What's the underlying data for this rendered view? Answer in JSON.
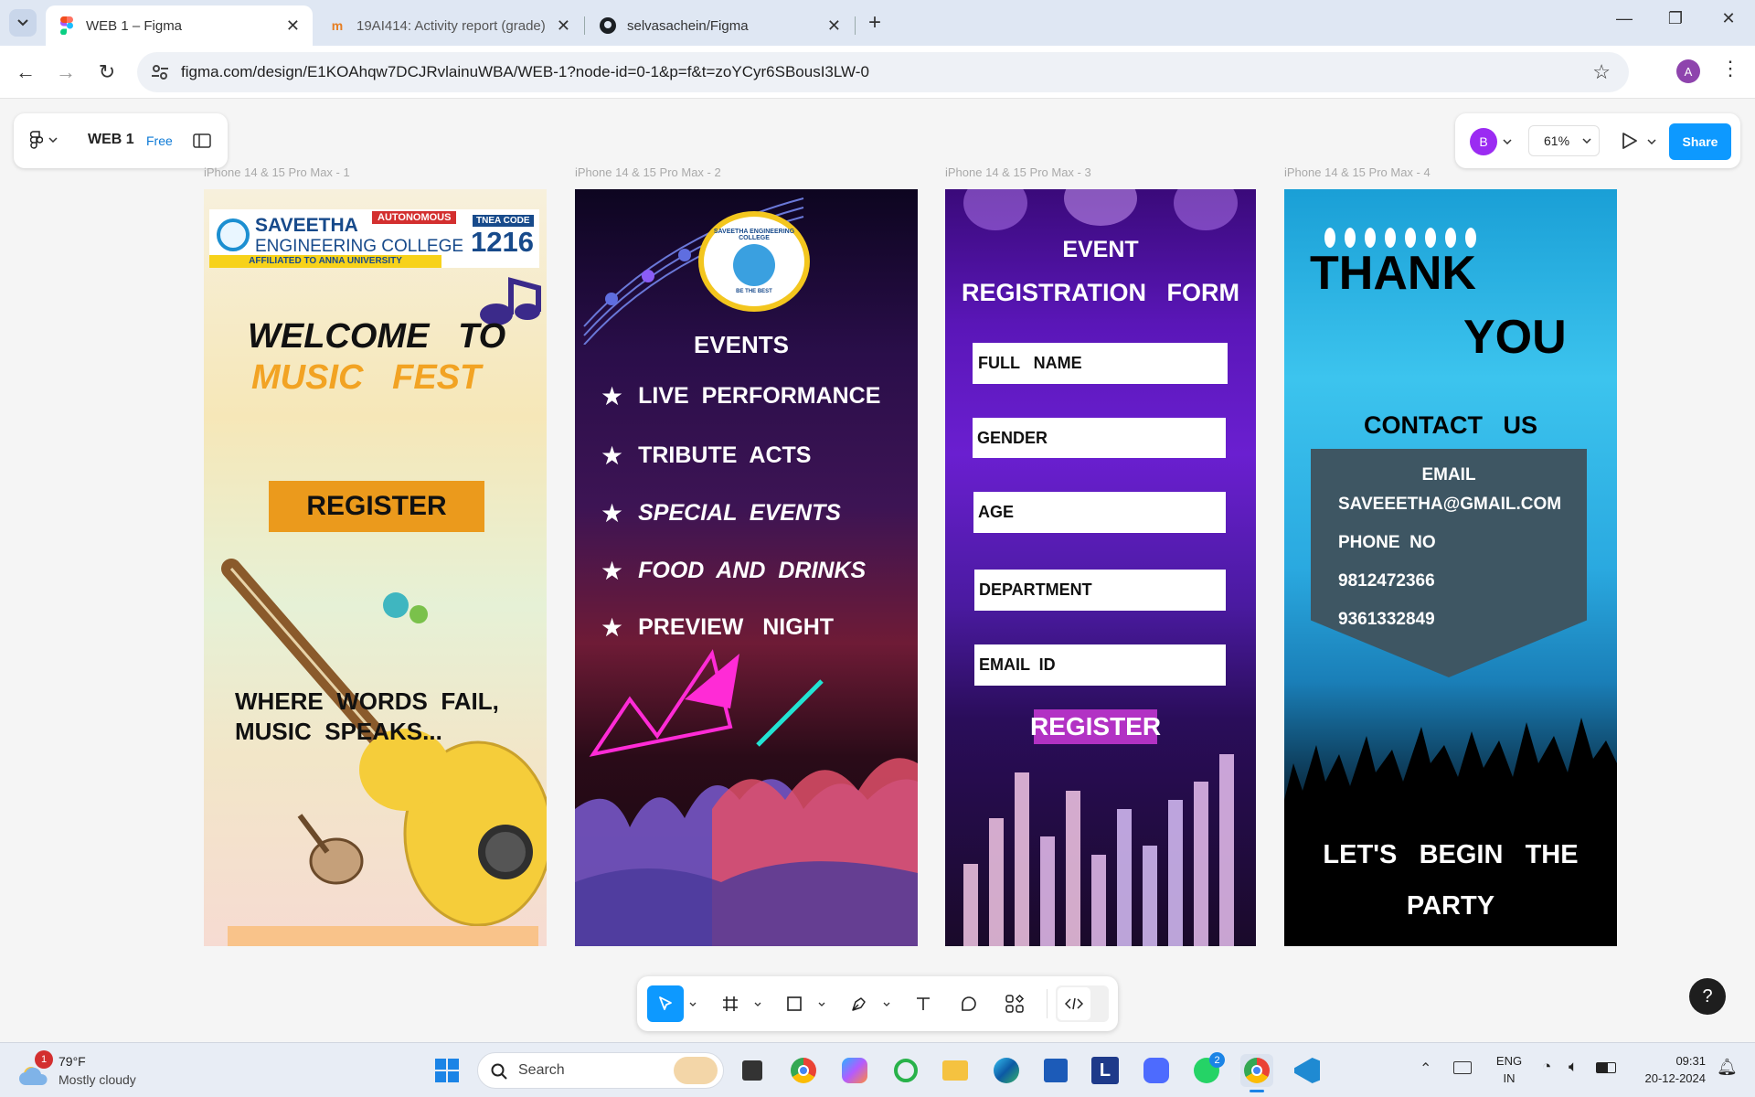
{
  "browser": {
    "tabs": [
      {
        "title": "WEB 1 – Figma"
      },
      {
        "title": "19AI414: Activity report (grade)"
      },
      {
        "title": "selvasachein/Figma"
      }
    ],
    "url": "figma.com/design/E1KOAhqw7DCJRvlainuWBA/WEB-1?node-id=0-1&p=f&t=zoYCyr6SBousI3LW-0",
    "profile_initial": "A"
  },
  "figma": {
    "file_name": "WEB 1",
    "plan_badge": "Free",
    "user_initial": "B",
    "zoom": "61%",
    "share_label": "Share",
    "help_label": "?"
  },
  "frames": [
    {
      "label": "iPhone 14 & 15 Pro Max - 1"
    },
    {
      "label": "iPhone 14 & 15 Pro Max - 2"
    },
    {
      "label": "iPhone 14 & 15 Pro Max - 3"
    },
    {
      "label": "iPhone 14 & 15 Pro Max - 4"
    }
  ],
  "frame1": {
    "college_line1": "SAVEETHA",
    "college_line2": "ENGINEERING COLLEGE",
    "autonomous": "AUTONOMOUS",
    "affiliated": "AFFILIATED TO ANNA UNIVERSITY",
    "tnea_label": "TNEA CODE",
    "tnea_code": "1216",
    "welcome": "WELCOME   TO",
    "music_fest": "MUSIC   FEST",
    "register": "REGISTER",
    "tagline1": "WHERE  WORDS  FAIL,",
    "tagline2": "MUSIC  SPEAKS..."
  },
  "frame2": {
    "emblem_top": "SAVEETHA ENGINEERING COLLEGE",
    "emblem_bottom": "BE THE BEST",
    "heading": "EVENTS",
    "items": [
      "LIVE  PERFORMANCE",
      "TRIBUTE  ACTS",
      "SPECIAL  EVENTS",
      "FOOD  AND  DRINKS",
      "PREVIEW   NIGHT"
    ]
  },
  "frame3": {
    "title1": "EVENT",
    "title2": "REGISTRATION   FORM",
    "fields": [
      "FULL   NAME",
      "GENDER",
      "AGE",
      "DEPARTMENT",
      "EMAIL  ID"
    ],
    "register": "REGISTER"
  },
  "frame4": {
    "thank": "THANK",
    "you": "YOU",
    "contact": "CONTACT   US",
    "email_label": "EMAIL",
    "email": "SAVEEETHA@GMAIL.COM",
    "phone_label": "PHONE  NO",
    "phone1": "9812472366",
    "phone2": "9361332849",
    "begin1": "LET'S   BEGIN   THE",
    "begin2": "PARTY"
  },
  "taskbar": {
    "weather_temp": "79°F",
    "weather_desc": "Mostly cloudy",
    "weather_badge": "1",
    "search_placeholder": "Search",
    "lang1": "ENG",
    "lang2": "IN",
    "time": "09:31",
    "date": "20-12-2024",
    "whatsapp_badge": "2"
  }
}
